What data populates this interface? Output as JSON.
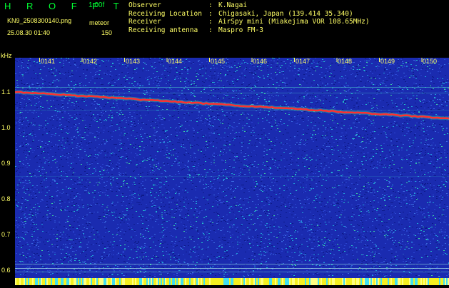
{
  "header": {
    "app_name": "H R O F F T",
    "version": "1.00f",
    "filename": "KN9_2508300140.png",
    "mode": "meteor",
    "datetime": "25.08.30 01:40",
    "count": "150"
  },
  "info": {
    "rows": [
      {
        "key": "Observer",
        "value": "K.Nagai"
      },
      {
        "key": "Receiving Location",
        "value": "Chigasaki, Japan (139.414 35.340)"
      },
      {
        "key": "Receiver",
        "value": "AirSpy mini (Miakejima VOR 108.65MHz)"
      },
      {
        "key": "Receiving antenna",
        "value": "Maspro FM-3"
      }
    ]
  },
  "axes": {
    "y_unit": "kHz",
    "y_ticks": [
      "1.1",
      "1.0",
      "0.9",
      "0.8",
      "0.7",
      "0.6"
    ],
    "x_ticks": [
      "0141",
      "0142",
      "0143",
      "0144",
      "0145",
      "0146",
      "0147",
      "0148",
      "0149",
      "0150"
    ]
  },
  "colors": {
    "background": "#000000",
    "label_yellow": "#ffff66",
    "title_green": "#00ff33",
    "spectrum_base": "#1a2bb0",
    "signal_trace": "#ff3030"
  }
}
